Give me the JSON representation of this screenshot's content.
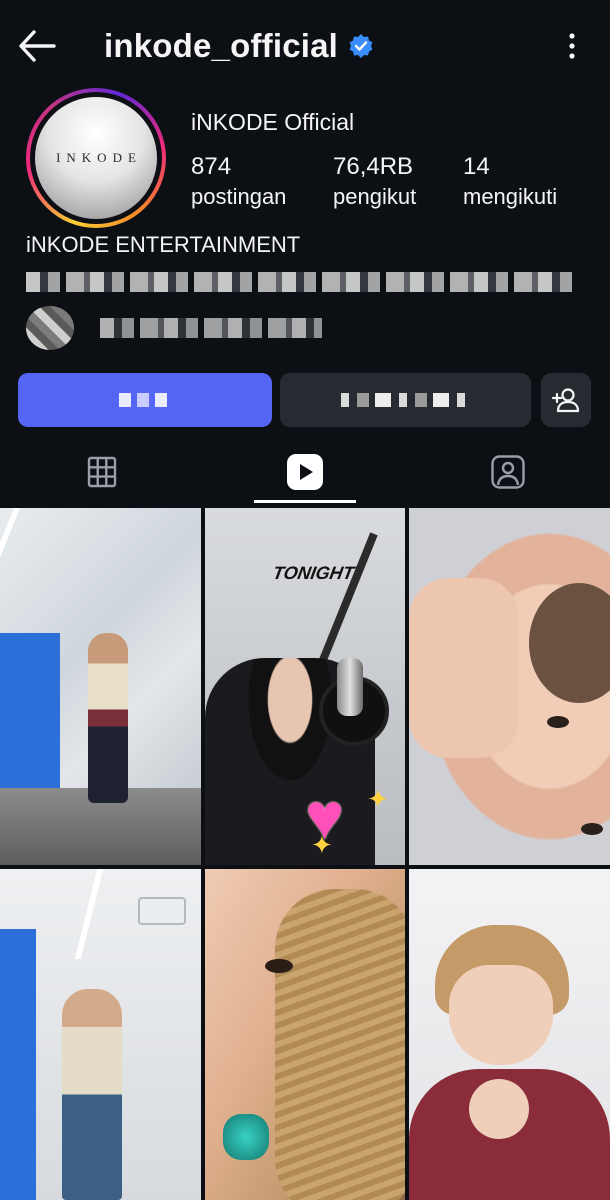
{
  "header": {
    "back_icon": "arrow-left-icon",
    "username": "inkode_official",
    "verified_icon": "verified-badge-icon",
    "more_icon": "more-vertical-icon"
  },
  "profile": {
    "avatar_text": "INKODE",
    "display_name": "iNKODE Official",
    "stats": [
      {
        "value": "874",
        "label": "postingan"
      },
      {
        "value": "76,4RB",
        "label": "pengikut"
      },
      {
        "value": "14",
        "label": "mengikuti"
      }
    ],
    "bio_title": "iNKODE ENTERTAINMENT"
  },
  "actions": {
    "add_user_icon": "add-user-icon"
  },
  "tabs": [
    {
      "name": "posts",
      "icon": "grid-icon"
    },
    {
      "name": "reels",
      "icon": "reels-play-icon",
      "selected": true
    },
    {
      "name": "tagged",
      "icon": "tagged-person-icon"
    }
  ],
  "grid": {
    "tiles": [
      {
        "overlay_text": ""
      },
      {
        "overlay_text": "TONIGHT"
      },
      {
        "overlay_text": ""
      },
      {
        "overlay_text": ""
      },
      {
        "overlay_text": ""
      },
      {
        "overlay_text": ""
      }
    ]
  },
  "colors": {
    "background": "#0c0f14",
    "primary_button": "#5566f6",
    "secondary_button": "#262a31",
    "verified": "#3a8dff"
  }
}
